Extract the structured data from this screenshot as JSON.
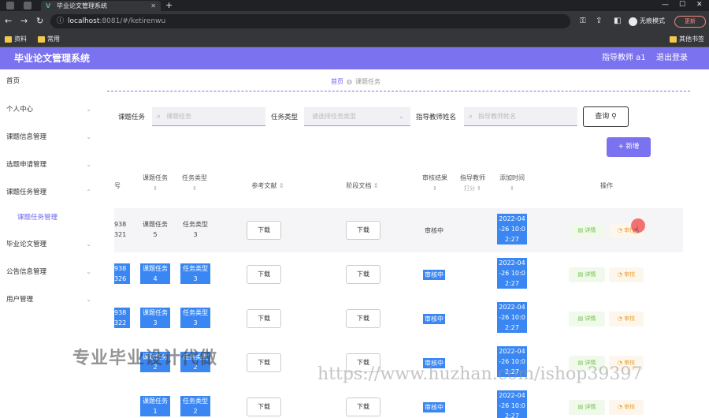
{
  "browser": {
    "tab_title": "毕业论文管理系统",
    "address_host": "localhost",
    "address_path": ":8081/#/ketirenwu",
    "incognito_label": "无痕模式",
    "update_label": "更新",
    "bookmarks": [
      "资料",
      "常用"
    ],
    "other_bookmarks": "其他书签"
  },
  "header": {
    "title": "毕业论文管理系统",
    "user": "指导教师 a1",
    "logout": "退出登录"
  },
  "sidebar": {
    "items": [
      {
        "label": "首页"
      },
      {
        "label": "个人中心"
      },
      {
        "label": "课题信息管理"
      },
      {
        "label": "选题申请管理"
      },
      {
        "label": "课题任务管理"
      },
      {
        "label": "毕业论文管理"
      },
      {
        "label": "公告信息管理"
      },
      {
        "label": "用户管理"
      }
    ],
    "active_sub": "课题任务管理"
  },
  "breadcrumb": {
    "home": "首页",
    "current": "课题任务"
  },
  "filters": {
    "task_label": "课题任务",
    "task_placeholder": "课题任务",
    "type_label": "任务类型",
    "type_placeholder": "请选择任务类型",
    "teacher_label": "指导教师姓名",
    "teacher_placeholder": "指导教师姓名",
    "query": "查询",
    "add": "+ 新增"
  },
  "table": {
    "headers": {
      "no": "号",
      "task": "课题任务",
      "type": "任务类型",
      "ref": "参考文献",
      "stage": "阶段文档",
      "status": "审核结果",
      "teacher": "指导教师",
      "score": "打分",
      "time": "添加时间",
      "ops": "操作"
    },
    "download": "下载",
    "detail": "详情",
    "review": "审核",
    "rows": [
      {
        "no1": "938",
        "no2": "321",
        "task1": "课题任务",
        "task2": "5",
        "type1": "任务类型",
        "type2": "3",
        "status": "审核中",
        "time1": "2022-04",
        "time2": "-26 10:0",
        "time3": "2:27"
      },
      {
        "no1": "938",
        "no2": "326",
        "task1": "课题任务",
        "task2": "4",
        "type1": "任务类型",
        "type2": "3",
        "status": "审核中",
        "time1": "2022-04",
        "time2": "-26 10:0",
        "time3": "2:27"
      },
      {
        "no1": "938",
        "no2": "322",
        "task1": "课题任务",
        "task2": "3",
        "type1": "任务类型",
        "type2": "3",
        "status": "审核中",
        "time1": "2022-04",
        "time2": "-26 10:0",
        "time3": "2:27"
      },
      {
        "no1": "",
        "no2": "",
        "task1": "课题任务",
        "task2": "2",
        "type1": "任务类型",
        "type2": "2",
        "status": "审核中",
        "time1": "2022-04",
        "time2": "-26 10:0",
        "time3": "2:27"
      },
      {
        "no1": "",
        "no2": "",
        "task1": "课题任务",
        "task2": "1",
        "type1": "任务类型",
        "type2": "2",
        "status": "审核中",
        "time1": "2022-04",
        "time2": "-26 10:0",
        "time3": "2:27"
      }
    ]
  },
  "watermarks": {
    "text1": "专业毕业设计代做",
    "text2": "https://www.huzhan.com/ishop39397"
  }
}
